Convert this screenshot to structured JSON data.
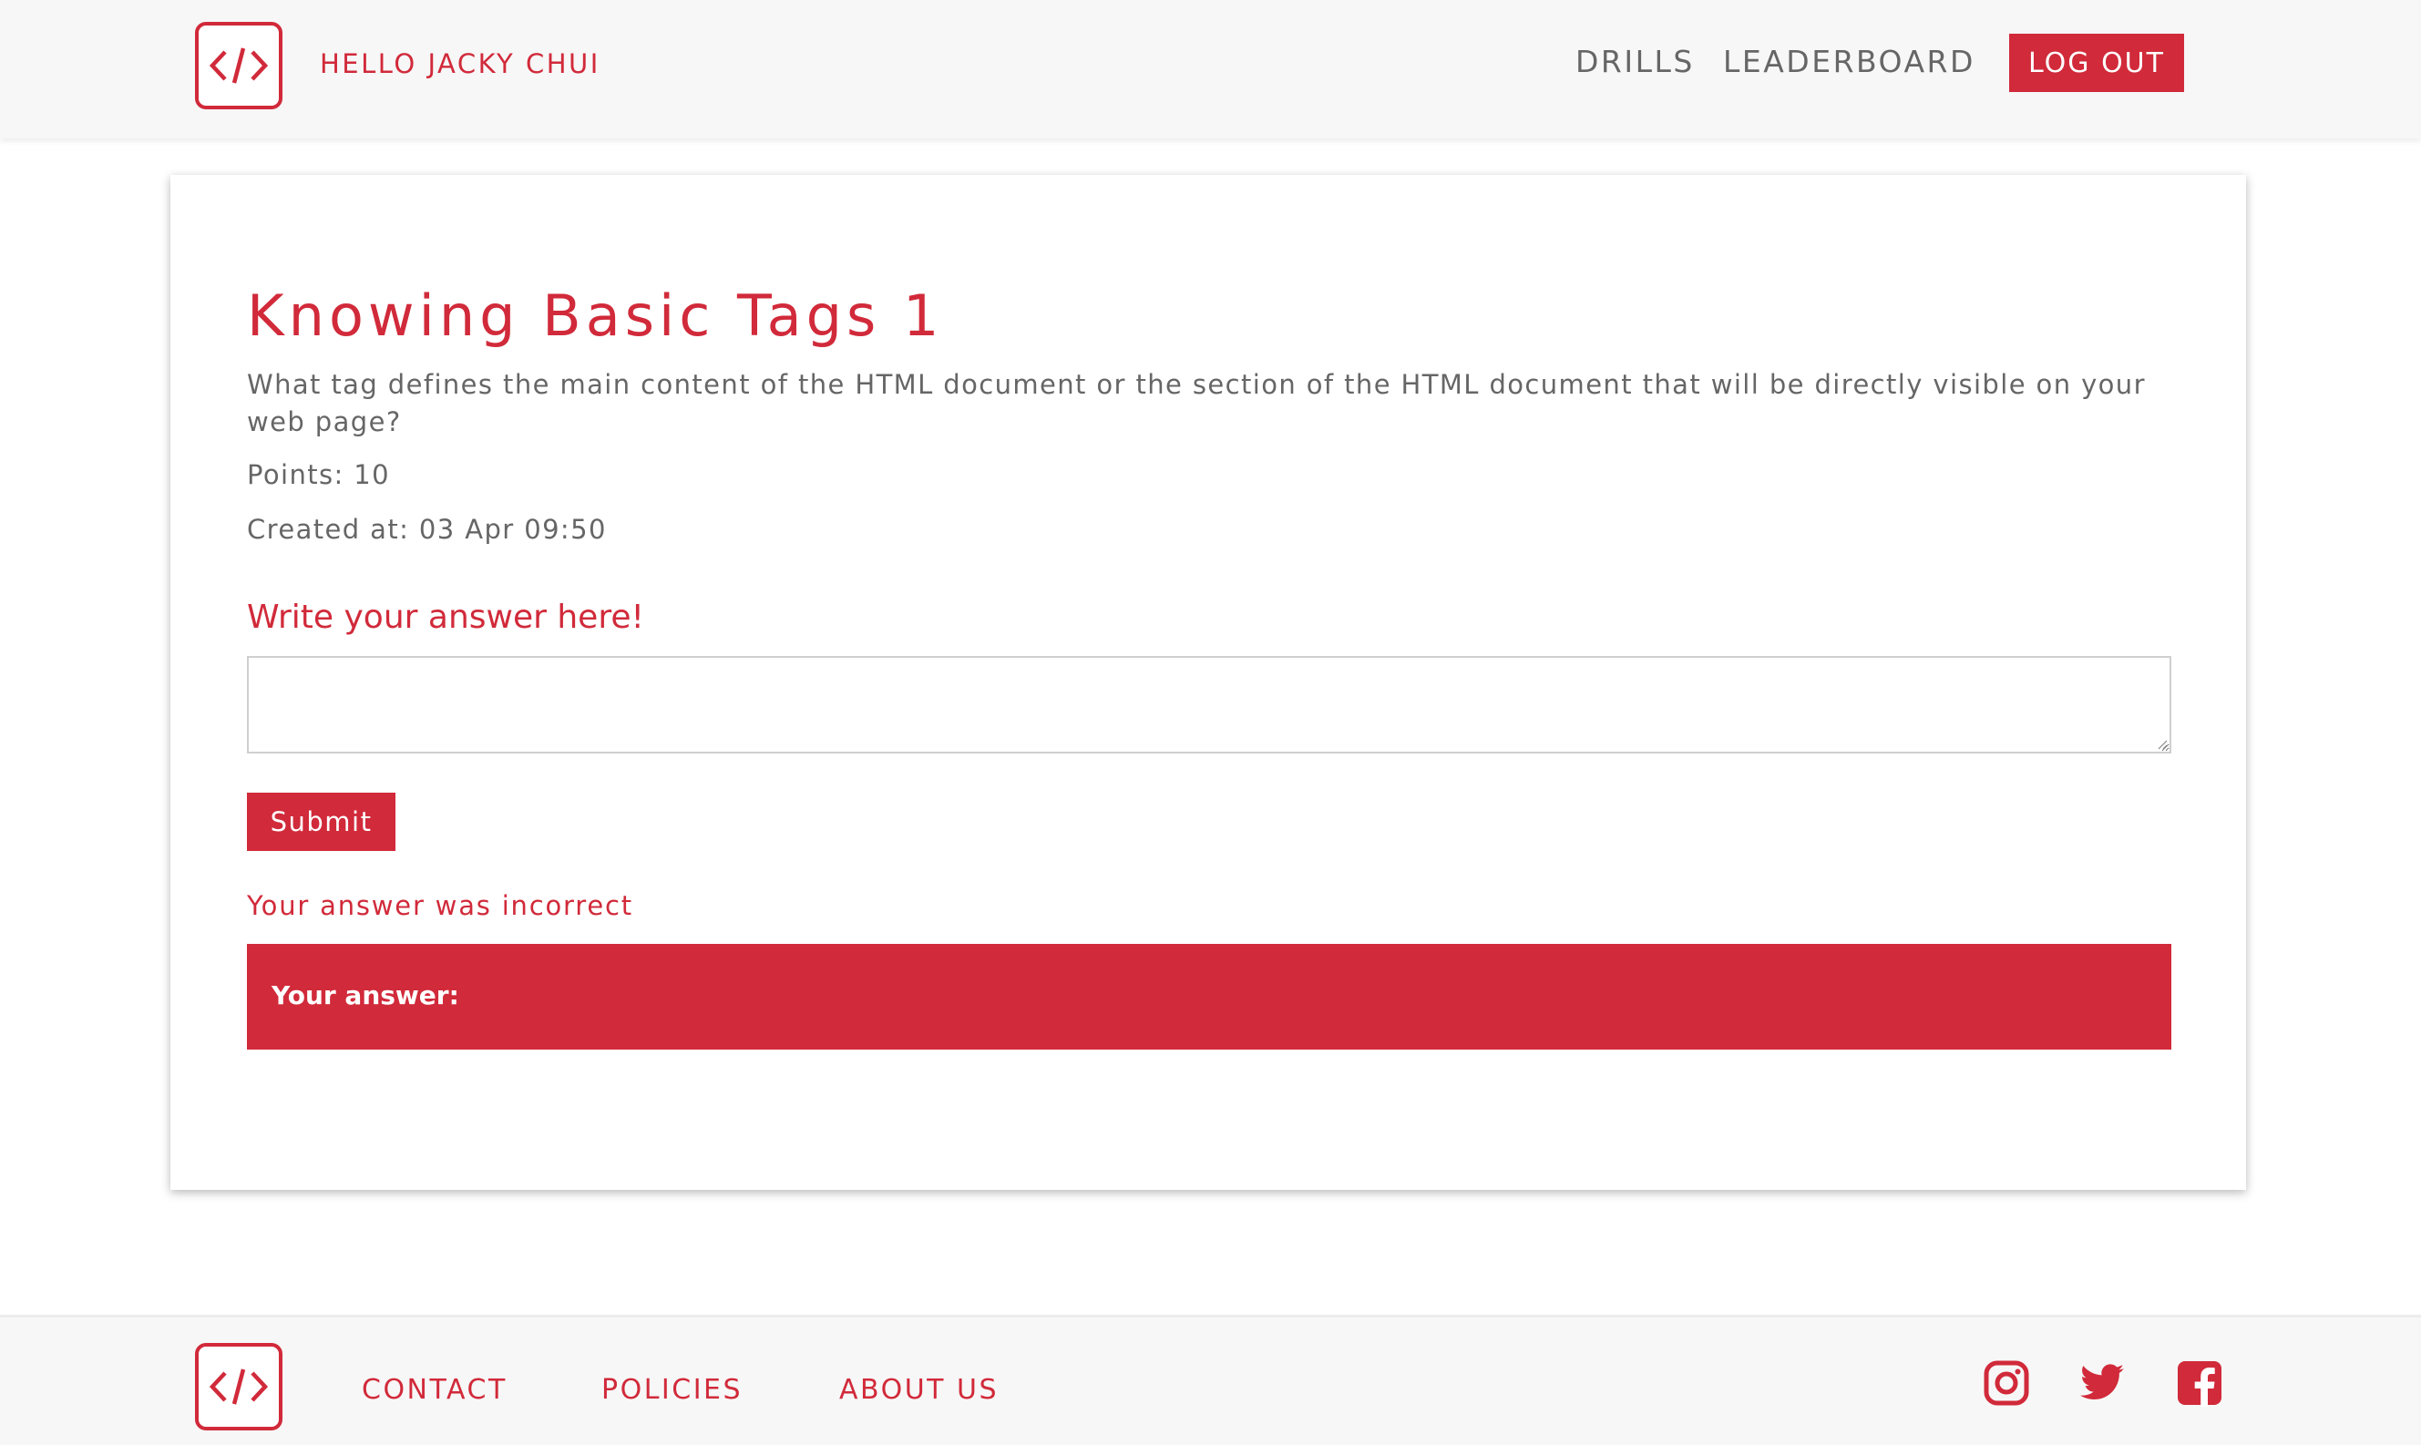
{
  "header": {
    "greeting": "HELLO JACKY CHUI",
    "nav": {
      "drills": "DRILLS",
      "leaderboard": "LEADERBOARD"
    },
    "logout_label": "LOG OUT"
  },
  "drill": {
    "title": "Knowing Basic Tags 1",
    "question": "What tag defines the main content of the HTML document or the section of the HTML document that will be directly visible on your web page?",
    "points": "Points: 10",
    "created": "Created at: 03 Apr 09:50",
    "answer_label": "Write your answer here!",
    "answer_value": "",
    "submit_label": "Submit",
    "result_message": "Your answer was incorrect",
    "your_answer_label": "Your answer:"
  },
  "footer": {
    "links": {
      "contact": "CONTACT",
      "policies": "POLICIES",
      "about": "ABOUT US"
    },
    "social_icons": [
      "instagram-icon",
      "twitter-icon",
      "facebook-icon"
    ]
  },
  "colors": {
    "accent": "#d12a3a",
    "text": "#666666",
    "header_bg": "#f7f7f7"
  },
  "icons": {
    "logo": "code-brackets-icon"
  }
}
